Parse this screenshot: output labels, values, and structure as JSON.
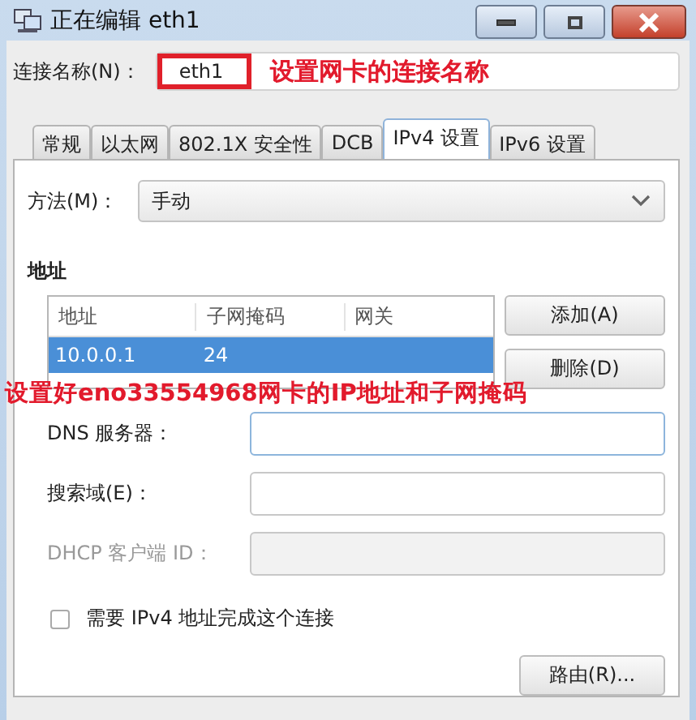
{
  "window": {
    "title": "正在编辑 eth1"
  },
  "connection_name": {
    "label": "连接名称(N)：",
    "value": "eth1",
    "highlighted": true
  },
  "annotations": [
    {
      "text": "设置网卡的连接名称"
    },
    {
      "text": "设置好eno33554968网卡的IP地址和子网掩码"
    }
  ],
  "tabs": [
    {
      "label": "常规",
      "selected": false
    },
    {
      "label": "以太网",
      "selected": false
    },
    {
      "label": "802.1X 安全性",
      "selected": false
    },
    {
      "label": "DCB",
      "selected": false
    },
    {
      "label": "IPv4 设置",
      "selected": true
    },
    {
      "label": "IPv6 设置",
      "selected": false
    }
  ],
  "method": {
    "label": "方法(M)：",
    "value": "手动"
  },
  "addresses": {
    "heading": "地址",
    "columns": [
      "地址",
      "子网掩码",
      "网关"
    ],
    "rows": [
      {
        "cells": [
          "10.0.0.1",
          "24",
          ""
        ],
        "selected": true
      }
    ],
    "buttons": [
      "添加(A)",
      "删除(D)"
    ]
  },
  "fields": [
    {
      "label": "DNS 服务器：",
      "disabled": false,
      "focused": true
    },
    {
      "label": "搜索域(E)：",
      "disabled": false,
      "focused": false
    },
    {
      "label": "DHCP 客户端 ID：",
      "disabled": true,
      "focused": false
    }
  ],
  "checkbox": {
    "label": "需要 IPv4 地址完成这个连接",
    "checked": false
  },
  "route_button": "路由(R)..."
}
